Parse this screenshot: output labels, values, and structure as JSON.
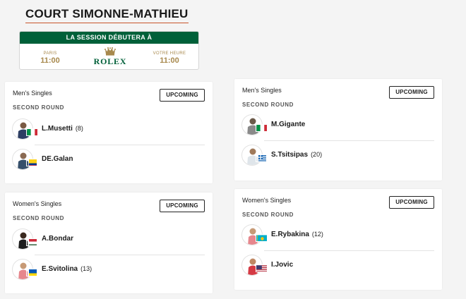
{
  "court": {
    "title": "COURT SIMONNE-MATHIEU"
  },
  "session": {
    "header": "LA SESSION DÉBUTERA À",
    "paris_label": "PARIS",
    "paris_time": "11:00",
    "brand": "ROLEX",
    "local_label": "VOTRE HEURE",
    "local_time": "11:00",
    "header_color": "#006039",
    "gold_color": "#a8894d"
  },
  "matches": [
    {
      "event": "Men's Singles",
      "round": "SECOND ROUND",
      "status": "UPCOMING",
      "players": [
        {
          "name": "L.Musetti",
          "seed": "(8)",
          "flag_icon": "italy-flag-icon"
        },
        {
          "name": "DE.Galan",
          "seed": "",
          "flag_icon": "colombia-flag-icon"
        }
      ]
    },
    {
      "event": "Men's Singles",
      "round": "SECOND ROUND",
      "status": "UPCOMING",
      "players": [
        {
          "name": "M.Gigante",
          "seed": "",
          "flag_icon": "italy-flag-icon"
        },
        {
          "name": "S.Tsitsipas",
          "seed": "(20)",
          "flag_icon": "greece-flag-icon"
        }
      ]
    },
    {
      "event": "Women's Singles",
      "round": "SECOND ROUND",
      "status": "UPCOMING",
      "players": [
        {
          "name": "A.Bondar",
          "seed": "",
          "flag_icon": "hungary-flag-icon"
        },
        {
          "name": "E.Svitolina",
          "seed": "(13)",
          "flag_icon": "ukraine-flag-icon"
        }
      ]
    },
    {
      "event": "Women's Singles",
      "round": "SECOND ROUND",
      "status": "UPCOMING",
      "players": [
        {
          "name": "E.Rybakina",
          "seed": "(12)",
          "flag_icon": "kazakhstan-flag-icon"
        },
        {
          "name": "I.Jovic",
          "seed": "",
          "flag_icon": "usa-flag-icon"
        }
      ]
    }
  ]
}
